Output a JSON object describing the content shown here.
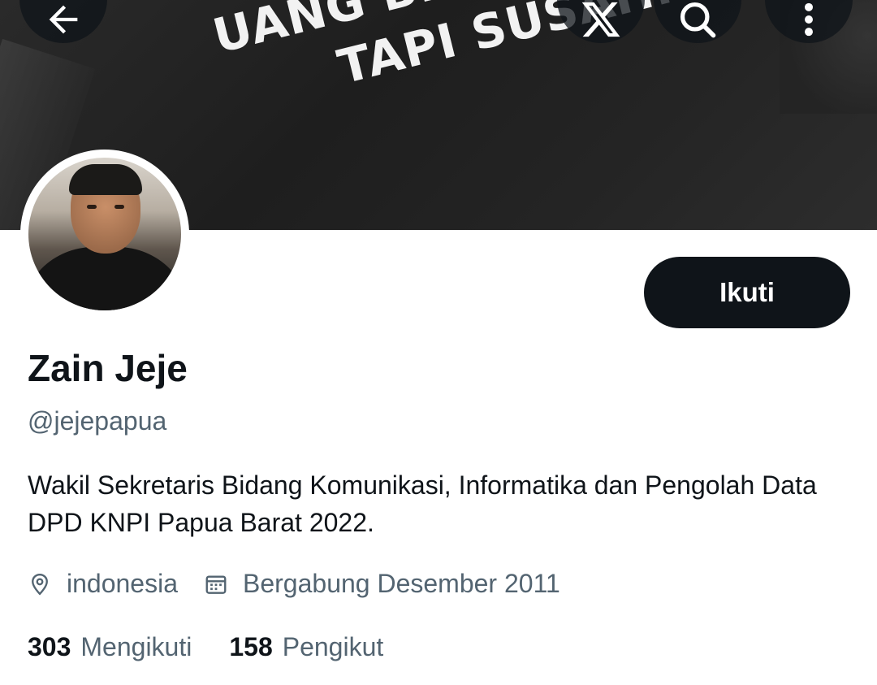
{
  "banner": {
    "line1": "UANG BISA DICARI",
    "line2": "TAPI SUSAH."
  },
  "header": {
    "icons": [
      "back-arrow-icon",
      "x-logo-icon",
      "search-icon",
      "more-vertical-icon"
    ]
  },
  "profile": {
    "follow_label": "Ikuti",
    "display_name": "Zain Jeje",
    "handle": "@jejepapua",
    "bio": "Wakil Sekretaris Bidang Komunikasi, Informatika dan Pengolah Data DPD KNPI Papua Barat 2022.",
    "location": "indonesia",
    "joined": "Bergabung Desember 2011",
    "following_count": "303",
    "following_label": "Mengikuti",
    "followers_count": "158",
    "followers_label": "Pengikut"
  },
  "colors": {
    "text_primary": "#0f1419",
    "text_secondary": "#536471",
    "button_bg": "#0f1419",
    "background": "#ffffff"
  }
}
